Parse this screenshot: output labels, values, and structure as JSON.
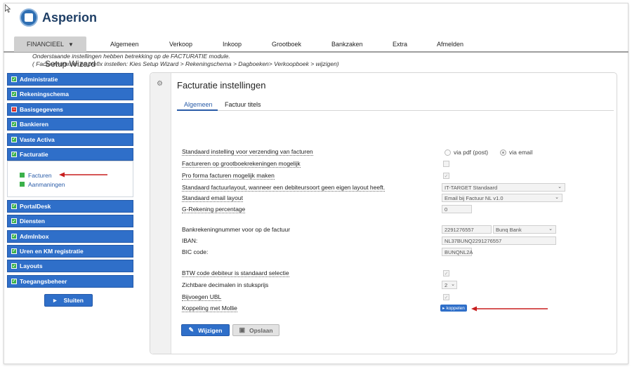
{
  "app": {
    "name": "Asperion"
  },
  "topnav": {
    "active": "FINANCIEEL",
    "tabs": [
      "Algemeen",
      "Verkoop",
      "Inkoop",
      "Grootboek",
      "Bankzaken",
      "Extra",
      "Afmelden"
    ]
  },
  "sidebar": {
    "title": "Setup Wizard",
    "items": [
      {
        "label": "Administratie",
        "status": "ok"
      },
      {
        "label": "Rekeningschema",
        "status": "ok"
      },
      {
        "label": "Basisgegevens",
        "status": "error"
      },
      {
        "label": "Bankieren",
        "status": "ok"
      },
      {
        "label": "Vaste Activa",
        "status": "ok"
      },
      {
        "label": "Facturatie",
        "status": "ok"
      },
      {
        "label": "PortalDesk",
        "status": "ok"
      },
      {
        "label": "Diensten",
        "status": "ok"
      },
      {
        "label": "AdmInbox",
        "status": "ok"
      },
      {
        "label": "Uren en KM registratie",
        "status": "ok"
      },
      {
        "label": "Layouts",
        "status": "ok"
      },
      {
        "label": "Toegangsbeheer",
        "status": "ok"
      }
    ],
    "subitems": [
      "Facturen",
      "Aanmaningen"
    ],
    "close_label": "Sluiten"
  },
  "panel": {
    "title": "Facturatie instellingen",
    "tabs": [
      "Algemeen",
      "Factuur titels"
    ],
    "info_line1": "Onderstaande instellingen hebben betrekking op de FACTURATIE module.",
    "info_line2": "( Factuurnummer en prefix instellen: Kies Setup Wizard > Rekeningschema > Dagboeken> Verkoopboek > wijzigen)",
    "labels": {
      "verzending": "Standaard instelling voor verzending van facturen",
      "grootboek": "Factureren op grootboekrekeningen mogelijk",
      "proforma": "Pro forma facturen mogelijk maken",
      "factuurlayout": "Standaard factuurlayout, wanneer een debiteursoort geen eigen layout heeft.",
      "emaillayout": "Standaard email layout",
      "grekening": "G-Rekening percentage",
      "bankrek": "Bankrekeningnummer voor op de factuur",
      "iban": "IBAN:",
      "bic": "BIC code:",
      "btw": "BTW code debiteur is standaard selectie",
      "decimalen": "Zichtbare decimalen in stuksprijs",
      "ubl": "Bijvoegen UBL",
      "mollie": "Koppeling met Mollie"
    },
    "values": {
      "radio_pdf": "via pdf (post)",
      "radio_email": "via email",
      "factuurlayout": "IT-TARGET Standaard",
      "emaillayout": "Email bij Factuur NL v1.0",
      "grekening": "0",
      "bankrek": "2291276557",
      "bank": "Bunq Bank",
      "iban": "NL37BUNQ2291276557",
      "bic": "BUNQNL2A",
      "decimalen": "2"
    },
    "buttons": {
      "koppelen": "koppelen",
      "wijzigen": "Wijzigen",
      "opslaan": "Opslaan"
    }
  },
  "colors": {
    "accent": "#2f6fc9",
    "ok": "#3bb14a",
    "error": "#d9302c",
    "annotation_arrow": "#c81e1e"
  }
}
